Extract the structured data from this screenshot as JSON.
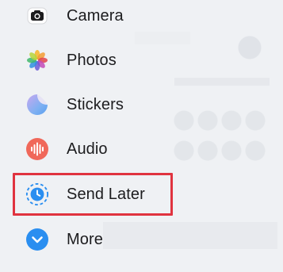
{
  "menu": {
    "items": [
      {
        "label": "Camera",
        "icon": "camera-icon"
      },
      {
        "label": "Photos",
        "icon": "photos-icon"
      },
      {
        "label": "Stickers",
        "icon": "stickers-icon"
      },
      {
        "label": "Audio",
        "icon": "audio-waveform-icon"
      },
      {
        "label": "Send Later",
        "icon": "clock-icon"
      },
      {
        "label": "More",
        "icon": "chevron-down-icon"
      }
    ],
    "highlighted_item": "Send Later",
    "highlight_color": "#e0333f",
    "colors": {
      "audio": "#f0685a",
      "send_later": "#2a8ef0",
      "more": "#2a8ef0",
      "camera_bg": "#1c1c1e"
    }
  }
}
